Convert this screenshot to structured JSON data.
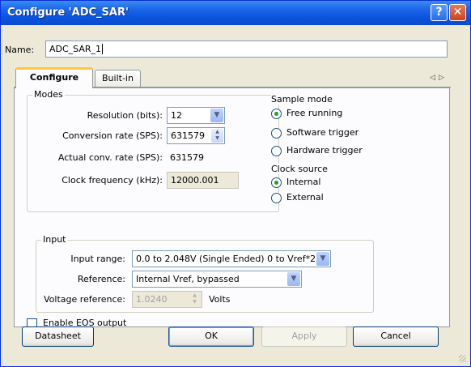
{
  "window": {
    "title": "Configure 'ADC_SAR'",
    "help_glyph": "?",
    "close_glyph": "✕"
  },
  "name_row": {
    "label": "Name:",
    "value": "ADC_SAR_1"
  },
  "tabs": [
    {
      "label": "Configure"
    },
    {
      "label": "Built-in"
    }
  ],
  "tab_nav": {
    "left": "◁",
    "right": "▷"
  },
  "modes": {
    "group_label": "Modes",
    "resolution_label": "Resolution (bits):",
    "resolution_value": "12",
    "conversion_rate_label": "Conversion rate (SPS):",
    "conversion_rate_value": "631579",
    "actual_rate_label": "Actual conv. rate (SPS):",
    "actual_rate_value": "631579",
    "clock_freq_label": "Clock frequency (kHz):",
    "clock_freq_value": "12000.001"
  },
  "sample_mode": {
    "group_label": "Sample mode",
    "options": [
      {
        "label": "Free running",
        "selected": true
      },
      {
        "label": "Software trigger",
        "selected": false
      },
      {
        "label": "Hardware trigger",
        "selected": false
      }
    ]
  },
  "clock_source": {
    "group_label": "Clock source",
    "options": [
      {
        "label": "Internal",
        "selected": true
      },
      {
        "label": "External",
        "selected": false
      }
    ]
  },
  "input": {
    "group_label": "Input",
    "input_range_label": "Input range:",
    "input_range_value": "0.0 to 2.048V (Single Ended) 0 to Vref*2",
    "reference_label": "Reference:",
    "reference_value": "Internal Vref, bypassed",
    "voltage_ref_label": "Voltage reference:",
    "voltage_ref_value": "1.0240",
    "voltage_ref_unit": "Volts"
  },
  "eos": {
    "label": "Enable EOS output",
    "checked": false
  },
  "buttons": {
    "datasheet": "Datasheet",
    "ok": "OK",
    "apply": "Apply",
    "cancel": "Cancel"
  },
  "colors": {
    "title_bar": "#0a53dd",
    "accent_radio": "#21a121",
    "dialog_bg": "#ece9d8"
  }
}
